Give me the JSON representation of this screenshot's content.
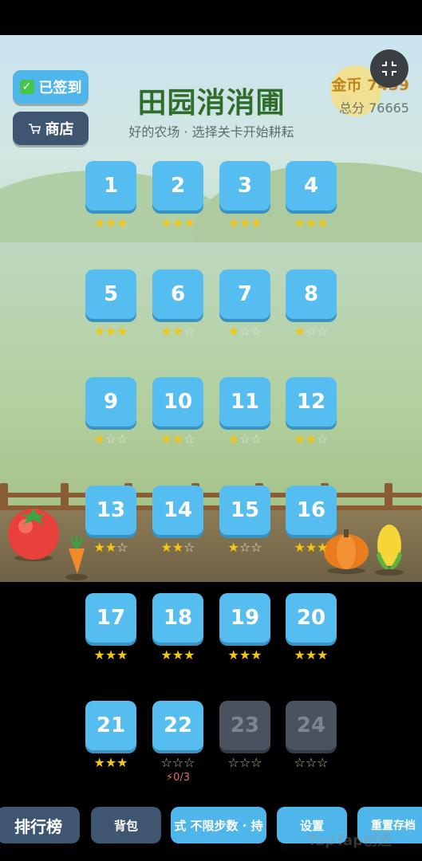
{
  "header": {
    "signin_label": "已签到",
    "shop_label": "商店",
    "title": "田园消消圃",
    "subtitle": "好的农场 · 选择关卡开始耕耘",
    "coins": "金币 7459",
    "score": "总分 76665"
  },
  "levels": [
    {
      "num": "1",
      "stars": "★★★",
      "earned": 3,
      "locked": false
    },
    {
      "num": "2",
      "stars": "★★★",
      "earned": 3,
      "locked": false
    },
    {
      "num": "3",
      "stars": "★★★",
      "earned": 3,
      "locked": false
    },
    {
      "num": "4",
      "stars": "★★★",
      "earned": 3,
      "locked": false
    },
    {
      "num": "5",
      "stars": "★★★",
      "earned": 3,
      "locked": false
    },
    {
      "num": "6",
      "stars": "★★☆",
      "earned": 2,
      "locked": false
    },
    {
      "num": "7",
      "stars": "★☆☆",
      "earned": 1,
      "locked": false
    },
    {
      "num": "8",
      "stars": "★☆☆",
      "earned": 1,
      "locked": false
    },
    {
      "num": "9",
      "stars": "★☆☆",
      "earned": 1,
      "locked": false
    },
    {
      "num": "10",
      "stars": "★★☆",
      "earned": 2,
      "locked": false
    },
    {
      "num": "11",
      "stars": "★☆☆",
      "earned": 1,
      "locked": false
    },
    {
      "num": "12",
      "stars": "★★☆",
      "earned": 2,
      "locked": false
    },
    {
      "num": "13",
      "stars": "★★☆",
      "earned": 2,
      "locked": false
    },
    {
      "num": "14",
      "stars": "★★☆",
      "earned": 2,
      "locked": false
    },
    {
      "num": "15",
      "stars": "★☆☆",
      "earned": 1,
      "locked": false
    },
    {
      "num": "16",
      "stars": "★★★",
      "earned": 3,
      "locked": false
    },
    {
      "num": "17",
      "stars": "★★★",
      "earned": 3,
      "locked": false
    },
    {
      "num": "18",
      "stars": "★★★",
      "earned": 3,
      "locked": false
    },
    {
      "num": "19",
      "stars": "★★★",
      "earned": 3,
      "locked": false
    },
    {
      "num": "20",
      "stars": "★★★",
      "earned": 3,
      "locked": false
    },
    {
      "num": "21",
      "stars": "★★★",
      "earned": 3,
      "locked": false
    },
    {
      "num": "22",
      "stars": "☆☆☆",
      "earned": 0,
      "locked": false,
      "energy": "⚡0/3"
    },
    {
      "num": "23",
      "stars": "☆☆☆",
      "earned": 0,
      "locked": true
    },
    {
      "num": "24",
      "stars": "☆☆☆",
      "earned": 0,
      "locked": true
    }
  ],
  "bottom": {
    "rank_label": "排行榜",
    "bag_label": "背包",
    "mode_label": "式 不限步数 · 持",
    "settings_label": "设置",
    "reset_label": "重置存档"
  },
  "watermark": "TapTap创造",
  "icons": {
    "signin": "checkbox-icon",
    "shop": "cart-icon",
    "fullscreen": "exit-fullscreen-icon"
  },
  "colors": {
    "tile": "#55bdf0",
    "tile_locked": "#4a5260",
    "star": "#f3c616",
    "title": "#2f6d2b",
    "coins": "#c0841c"
  }
}
